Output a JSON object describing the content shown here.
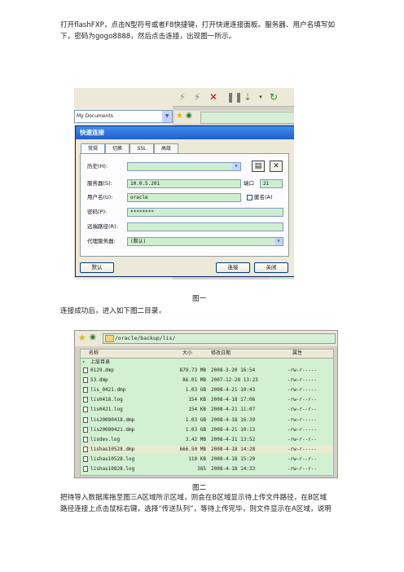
{
  "para1": {
    "line1": "打开flashFXP，点击N型符号或者F8快捷键，打开快速连接面板。服务器、用户名填写如",
    "line2": "下，密码为gogo8888，然后点击连接，出现图一所示。"
  },
  "figure1": {
    "path_value": "My Documents",
    "dialog": {
      "title": "快速连接",
      "tabs": [
        "常规",
        "切换",
        "SSL",
        "高级"
      ],
      "history_label": "历史(H):",
      "server_label": "服务器(S):",
      "server_value": "10.0.5.201",
      "port_label": "端口",
      "port_value": "21",
      "user_label": "用户名(U):",
      "user_value": "oracle",
      "anon_label": "匿名(A)",
      "password_label": "密码(P):",
      "password_value": "********",
      "remote_path_label": "远端路径(R):",
      "proxy_label": "代理服务器:",
      "proxy_value": "(默认)",
      "default_button": "默认",
      "connect_button": "连接",
      "close_button": "关闭"
    }
  },
  "caption1": "图一",
  "para2": "连接成功后，进入如下图二目录，",
  "figure2": {
    "path_value": "/oracle/backup/lis/",
    "headers": {
      "name": "名称",
      "size": "大小",
      "date": "修改日期",
      "attr": "属性"
    },
    "up_label": "上层目录",
    "rows": [
      {
        "name": "0129.dmp",
        "size": "879.73 MB",
        "date": "2008-3-20 16:54",
        "attr": "-rw-r-----"
      },
      {
        "name": "53.dmp",
        "size": "86.01 MB",
        "date": "2007-12-28 13:23",
        "attr": "-rw-r-----"
      },
      {
        "name": "lis_0421.dmp",
        "size": "1.03 GB",
        "date": "2008-4-21 10:43",
        "attr": "-rw-r-----"
      },
      {
        "name": "lis0418.log",
        "size": "154 KB",
        "date": "2008-4-18 17:06",
        "attr": "-rw-r--r--"
      },
      {
        "name": "lis0421.log",
        "size": "154 KB",
        "date": "2008-4-21 11:07",
        "attr": "-rw-r--r--"
      },
      {
        "name": "lis20080418.dmp",
        "size": "1.03 GB",
        "date": "2008-4-18 16:39",
        "attr": "-rw-r-----"
      },
      {
        "name": "lis20080421.dmp",
        "size": "1.03 GB",
        "date": "2008-4-21 10:13",
        "attr": "-rw-r-----"
      },
      {
        "name": "lisdev.log",
        "size": "3.42 MB",
        "date": "2008-4-21 13:52",
        "attr": "-rw-r--r--"
      },
      {
        "name": "lishas10528.dmp",
        "size": "666.50 MB",
        "date": "2008-4-18 14:28",
        "attr": "-rw-r-----"
      },
      {
        "name": "lishas10528.log",
        "size": "110 KB",
        "date": "2008-4-18 15:20",
        "attr": "-rw-r--r--"
      },
      {
        "name": "lishas10828.log",
        "size": "385",
        "date": "2008-4-18 14:33",
        "attr": "-rw-r--r--"
      }
    ]
  },
  "caption2": "图二",
  "para3": {
    "line1": "把待导入数据库拖至图三A区域所示区域，则会在B区域显示待上传文件路径，在B区域",
    "line2": "路径连接上点击鼠标右键，选择“传送队列”，等待上传完毕，则文件显示在A区域，说明"
  },
  "colors": {
    "field_green": "#cfeecf",
    "title_blue": "#1f5fd0"
  }
}
